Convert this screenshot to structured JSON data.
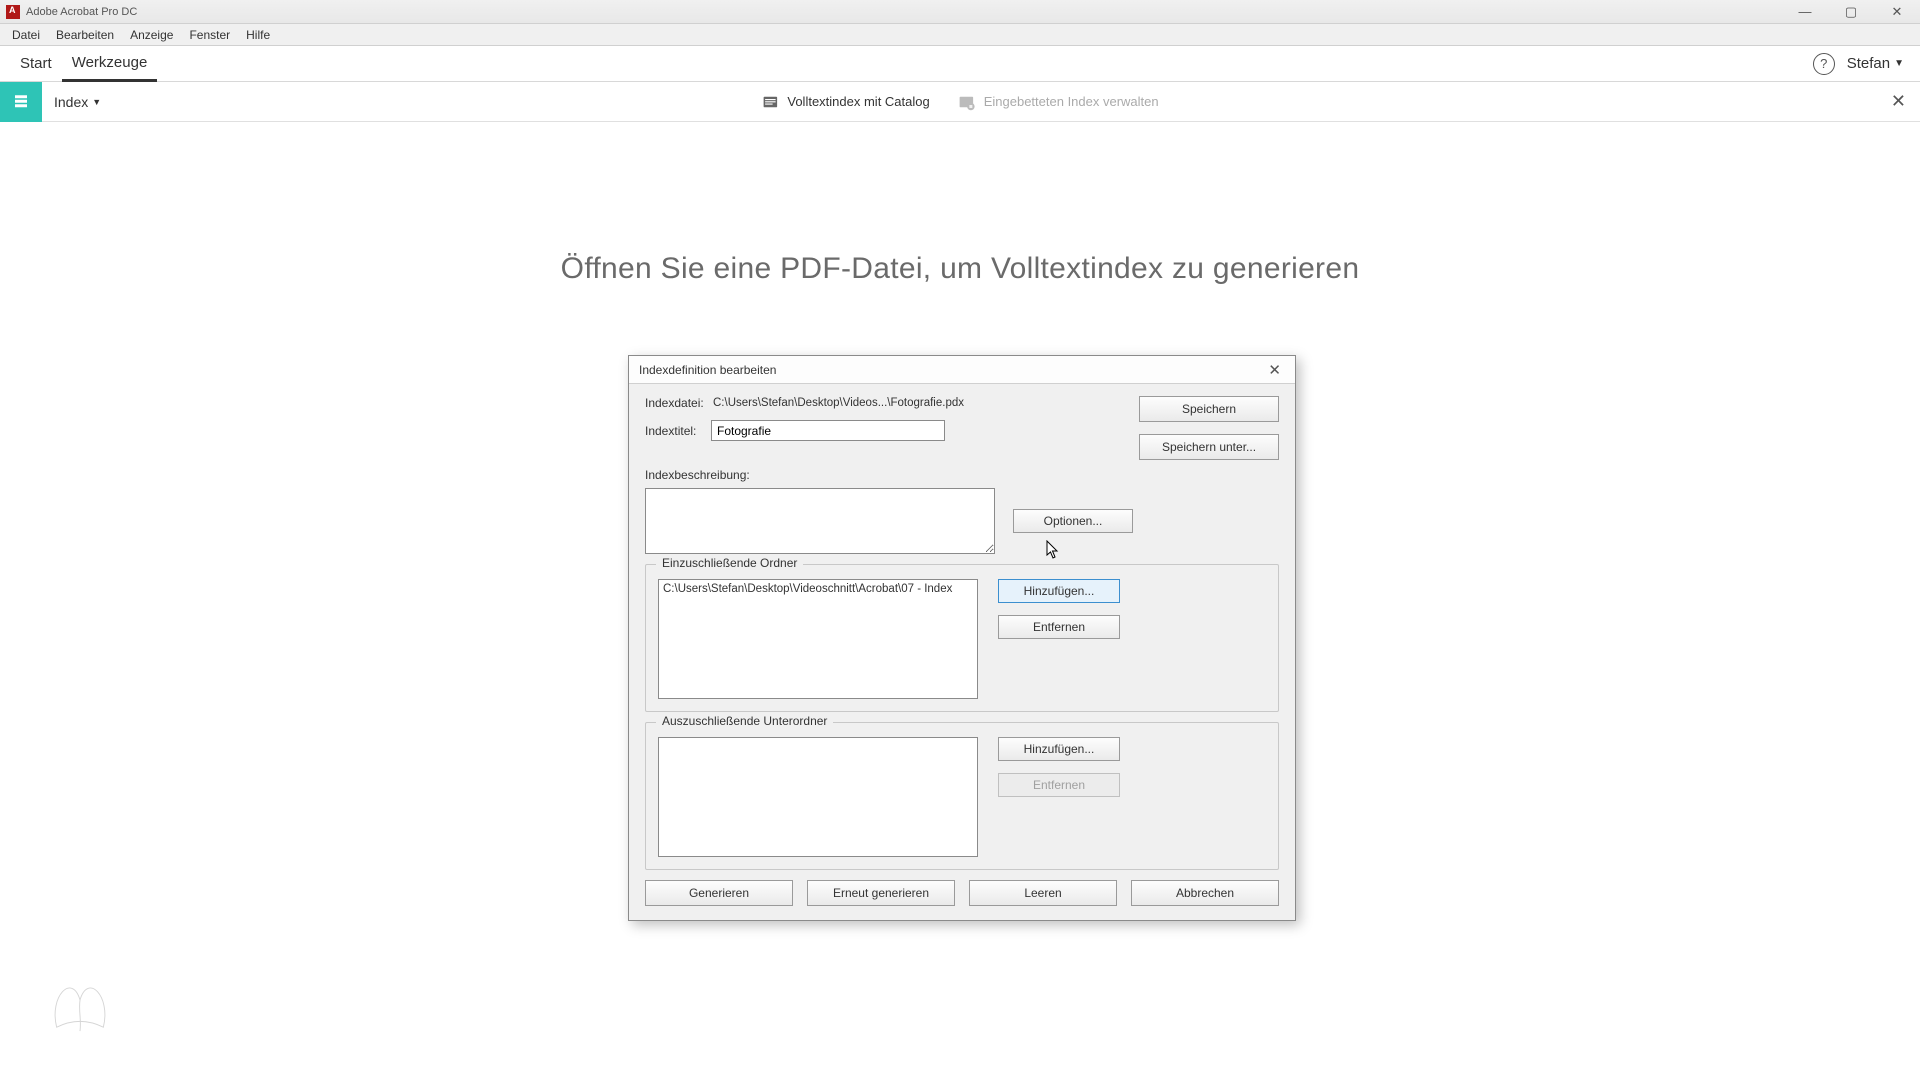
{
  "app": {
    "title": "Adobe Acrobat Pro DC"
  },
  "menu": {
    "file": "Datei",
    "edit": "Bearbeiten",
    "view": "Anzeige",
    "window": "Fenster",
    "help": "Hilfe"
  },
  "tabs": {
    "start": "Start",
    "tools": "Werkzeuge"
  },
  "user": {
    "name": "Stefan"
  },
  "subbar": {
    "tool_name": "Index",
    "fulltext": "Volltextindex mit Catalog",
    "manage_embedded": "Eingebetteten Index verwalten"
  },
  "bg_hint": "Öffnen Sie eine PDF-Datei, um Volltextindex zu generieren",
  "dialog": {
    "title": "Indexdefinition bearbeiten",
    "labels": {
      "indexfile": "Indexdatei:",
      "indextitle": "Indextitel:",
      "description": "Indexbeschreibung:",
      "include": "Einzuschließende Ordner",
      "exclude": "Auszuschließende Unterordner"
    },
    "values": {
      "indexfile_path": "C:\\Users\\Stefan\\Desktop\\Videos...\\Fotografie.pdx",
      "indextitle": "Fotografie",
      "description": "",
      "include_items": [
        "C:\\Users\\Stefan\\Desktop\\Videoschnitt\\Acrobat\\07 - Index"
      ],
      "exclude_items": []
    },
    "buttons": {
      "save": "Speichern",
      "save_as": "Speichern unter...",
      "options": "Optionen...",
      "add": "Hinzufügen...",
      "remove": "Entfernen",
      "generate": "Generieren",
      "regenerate": "Erneut generieren",
      "clear": "Leeren",
      "cancel": "Abbrechen"
    }
  }
}
